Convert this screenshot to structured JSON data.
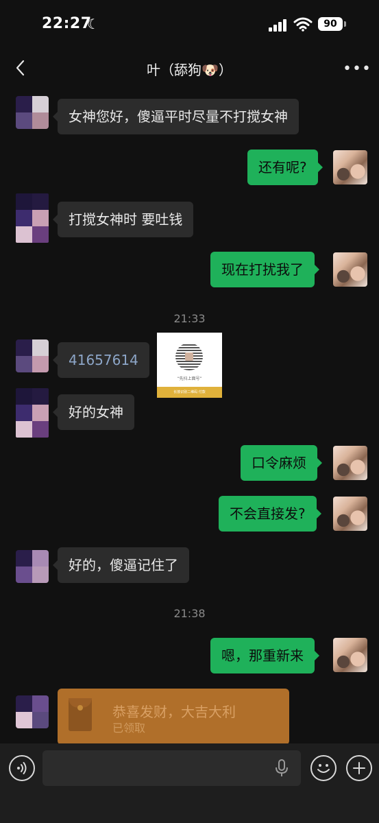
{
  "status_bar": {
    "time": "22:27",
    "battery": "90"
  },
  "header": {
    "title": "叶（舔狗🐶）",
    "back_icon": "chevron-left-icon",
    "more_icon": "more-dots-icon"
  },
  "messages": [
    {
      "side": "left",
      "text": "女神您好，傻逼平时尽量不打搅女神"
    },
    {
      "side": "right",
      "text": "还有呢?"
    },
    {
      "side": "left",
      "text": "打搅女神时 要吐钱"
    },
    {
      "side": "right",
      "text": "现在打扰我了"
    },
    {
      "timestamp": "21:33"
    },
    {
      "side": "left",
      "text": "41657614"
    },
    {
      "side": "left",
      "type": "image",
      "caption": "“先扫上面号”",
      "footer": "长按识别二维码 付款"
    },
    {
      "side": "left",
      "text": "好的女神"
    },
    {
      "side": "right",
      "text": "口令麻烦"
    },
    {
      "side": "right",
      "text": "不会直接发?"
    },
    {
      "side": "left",
      "text": "好的，傻逼记住了"
    },
    {
      "timestamp": "21:38"
    },
    {
      "side": "right",
      "text": "嗯，那重新来"
    },
    {
      "side": "left",
      "type": "red_packet",
      "title": "恭喜发财，大吉大利",
      "status": "已领取"
    }
  ],
  "input_bar": {
    "placeholder": "",
    "icons": [
      "voice-icon",
      "mic-icon",
      "emoji-icon",
      "plus-icon"
    ]
  },
  "colors": {
    "background": "#111111",
    "bubble_left": "#2c2c2c",
    "bubble_right": "#1fb15a",
    "red_packet": "#b06f2a"
  }
}
